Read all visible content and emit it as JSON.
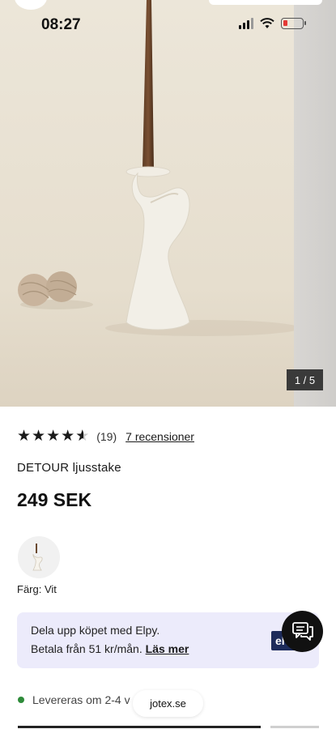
{
  "status_bar": {
    "time": "08:27",
    "battery_level": 0.15,
    "battery_color": "#e53935"
  },
  "gallery": {
    "counter": "1 / 5",
    "current": 1,
    "total": 5,
    "image_icon": "candle-holder-photo"
  },
  "product": {
    "rating": 4.5,
    "rating_count": "(19)",
    "reviews_link": "7 recensioner",
    "name": "DETOUR ljusstake",
    "price": "249 SEK",
    "color_label": "Färg: Vit"
  },
  "financing": {
    "line1": "Dela upp köpet med Elpy.",
    "line2_prefix": "Betala från 51 kr/mån.",
    "read_more": "Läs mer",
    "logo_text": "el",
    "background": "#ecebfb"
  },
  "delivery": {
    "text": "Levereras om 2-4 v",
    "status_color": "#2e8b3a"
  },
  "browser": {
    "url": "jotex.se"
  },
  "chat": {
    "icon": "chat-bubbles-icon"
  }
}
